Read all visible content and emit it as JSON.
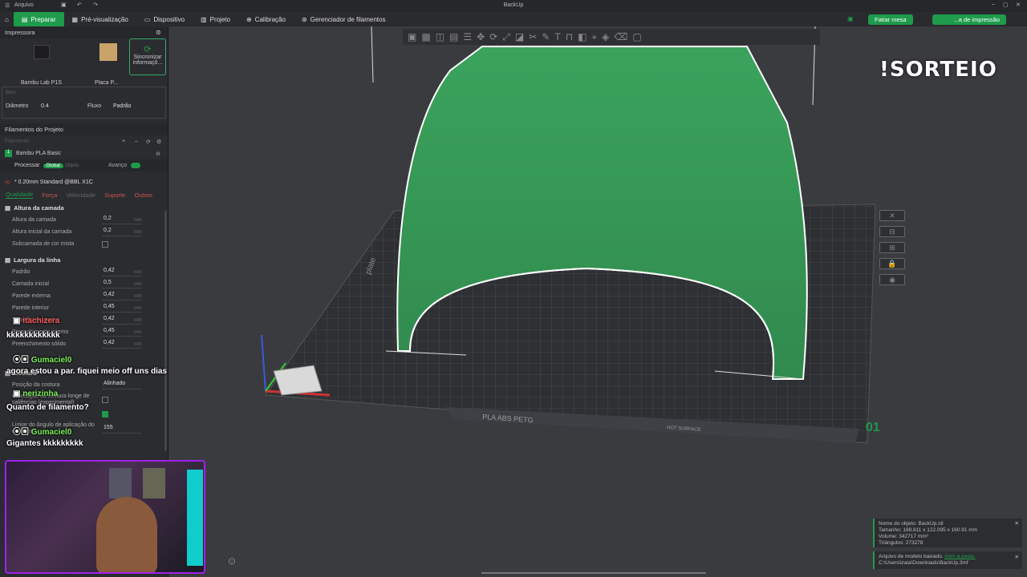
{
  "titlebar": {
    "menu": "Arquivo",
    "title": "BackUp"
  },
  "tabs": [
    {
      "label": "Preparar"
    },
    {
      "label": "Pré-visualização"
    },
    {
      "label": "Dispositivo"
    },
    {
      "label": "Projeto"
    },
    {
      "label": "Calibração"
    },
    {
      "label": "Gerenciador de filamentos"
    }
  ],
  "actions": {
    "slice": "Fatiar mesa",
    "print": "...a de impressão"
  },
  "printer": {
    "section": "Impressora",
    "name": "Bambu Lab P1S",
    "plate": "Placa P...",
    "sync": "Sincronizar informaçõ...",
    "nozzle_label": "Bico",
    "diameter_label": "Diâmetro",
    "diameter": "0.4",
    "flow_label": "Fluxo",
    "flow": "Padrão"
  },
  "filaments": {
    "section": "Filamentos do Projeto",
    "label": "Filamento",
    "item": "Bambu PLA Basic",
    "index": "1"
  },
  "process": {
    "label": "Processar",
    "global": "Global",
    "object": "Objeto",
    "advanced": "Avanço",
    "profile": "* 0.20mm Standard @BBL X1C"
  },
  "subtabs": [
    "Qualidade",
    "Força",
    "Velocidade",
    "Suporte",
    "Outros"
  ],
  "layer": {
    "title": "Altura da camada",
    "rows": [
      {
        "label": "Altura da camada",
        "value": "0,2",
        "unit": "mm"
      },
      {
        "label": "Altura inicial da camada",
        "value": "0,2",
        "unit": "mm"
      }
    ],
    "mixed": "Subcamada de cor mista"
  },
  "linewidth": {
    "title": "Largura da linha",
    "rows": [
      {
        "label": "Padrão",
        "value": "0,42",
        "unit": "mm"
      },
      {
        "label": "Camada inicial",
        "value": "0,5",
        "unit": "mm"
      },
      {
        "label": "Parede externa",
        "value": "0,42",
        "unit": "mm"
      },
      {
        "label": "Parede interior",
        "value": "0,45",
        "unit": "mm"
      },
      {
        "label": "Superfície superior",
        "value": "0,42",
        "unit": "mm"
      },
      {
        "label": "Preenchimento interno",
        "value": "0,45",
        "unit": "mm"
      },
      {
        "label": "Preenchimento sólido",
        "value": "0,42",
        "unit": "mm"
      }
    ]
  },
  "seam": {
    "title": "Costura",
    "pos_label": "Posição da costura",
    "pos": "Alinhado",
    "lip": "Colocação da costura longe de saliências (experimental)",
    "angle_label": "Limiar do ângulo de aplicação do cachecol",
    "angle": "155"
  },
  "chat": [
    {
      "user": "itachizera",
      "msg": "kkkkkkkkkkkk"
    },
    {
      "user": "Gumaciel0",
      "msg": "agora estou a par. fiquei meio off uns dias"
    },
    {
      "user": "nerizinha",
      "msg": "Quanto de filamento?"
    },
    {
      "user": "Gumaciel0",
      "msg": "Gigantes kkkkkkkkk"
    }
  ],
  "overlay": {
    "sorteio": "!SORTEIO",
    "plate_number": "01",
    "bed_label": "PLA  ABS  PETG",
    "bed_label2": "HOT SURFACE",
    "side_text": "plate"
  },
  "notif1": {
    "line1": "Nome do objeto: BackUp.stl",
    "line2": "Tamanho: 188.811 x 122.095 x 160.91 mm",
    "line3": "Volume: 342717 mm³",
    "line4": "Triângulos: 273278"
  },
  "notif2": {
    "line1": "Arquivo de modelo baixado.",
    "link": "Abrir a pasta.",
    "line2": "C:\\Users\\izaia\\Downloads\\BackUp.3mf"
  },
  "colors": {
    "accent": "#1f9b4c",
    "model": "#3aa35c"
  }
}
